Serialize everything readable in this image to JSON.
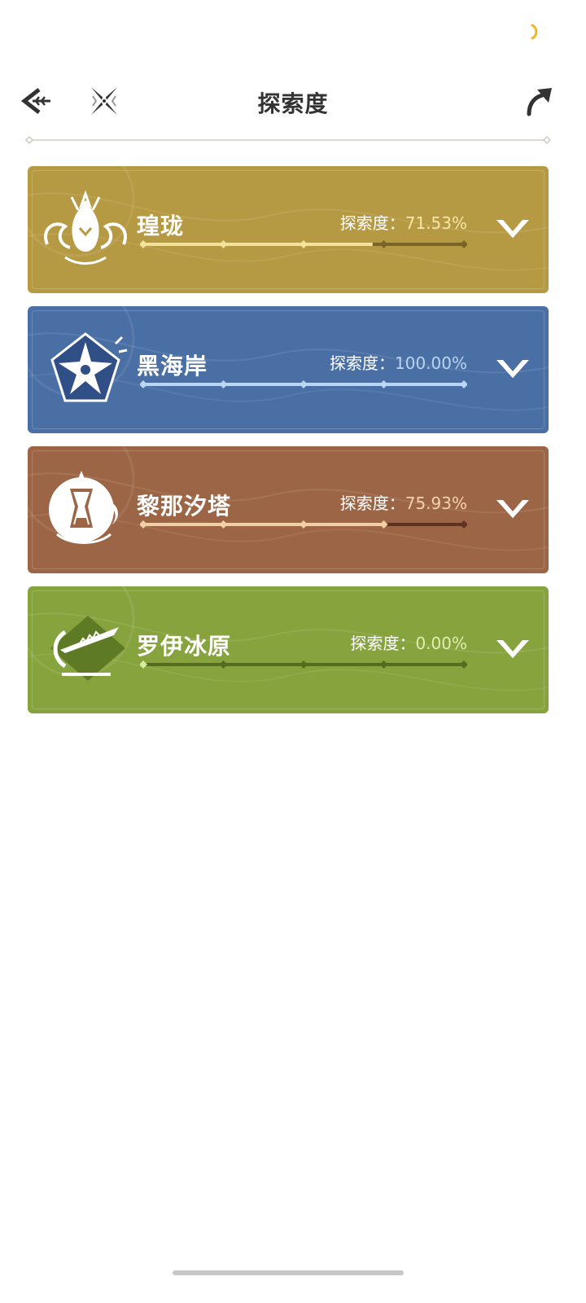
{
  "header": {
    "title": "探索度"
  },
  "progress_label": "探索度：",
  "regions": [
    {
      "name": "瑝珑",
      "progress_text": "71.53%",
      "progress": 0.7153,
      "color": "#b69a43",
      "fill_color": "#f3e29a",
      "empty_color": "#7b6428",
      "value_color": "#f6e5a6",
      "emblem": "dragon-emblem-icon"
    },
    {
      "name": "黑海岸",
      "progress_text": "100.00%",
      "progress": 1.0,
      "color": "#4a6fa5",
      "fill_color": "#b9d6f5",
      "empty_color": "#2d4b78",
      "value_color": "#b8d4f3",
      "emblem": "starflower-emblem-icon"
    },
    {
      "name": "黎那汐塔",
      "progress_text": "75.93%",
      "progress": 0.7593,
      "color": "#9c6646",
      "fill_color": "#f3cfa6",
      "empty_color": "#5e3420",
      "value_color": "#f5d1ad",
      "emblem": "hourglass-emblem-icon"
    },
    {
      "name": "罗伊冰原",
      "progress_text": "0.00%",
      "progress": 0.0,
      "color": "#87a33e",
      "fill_color": "#d9ec9a",
      "empty_color": "#566b1f",
      "value_color": "#dfedae",
      "emblem": "ice-blade-emblem-icon"
    }
  ],
  "icons": {
    "back": "back-arrow-icon",
    "home": "crossed-stars-icon",
    "share": "share-arrow-icon",
    "expand": "chevron-down-icon",
    "loading": "loading-spinner-icon"
  },
  "accent": "#f2b51c"
}
